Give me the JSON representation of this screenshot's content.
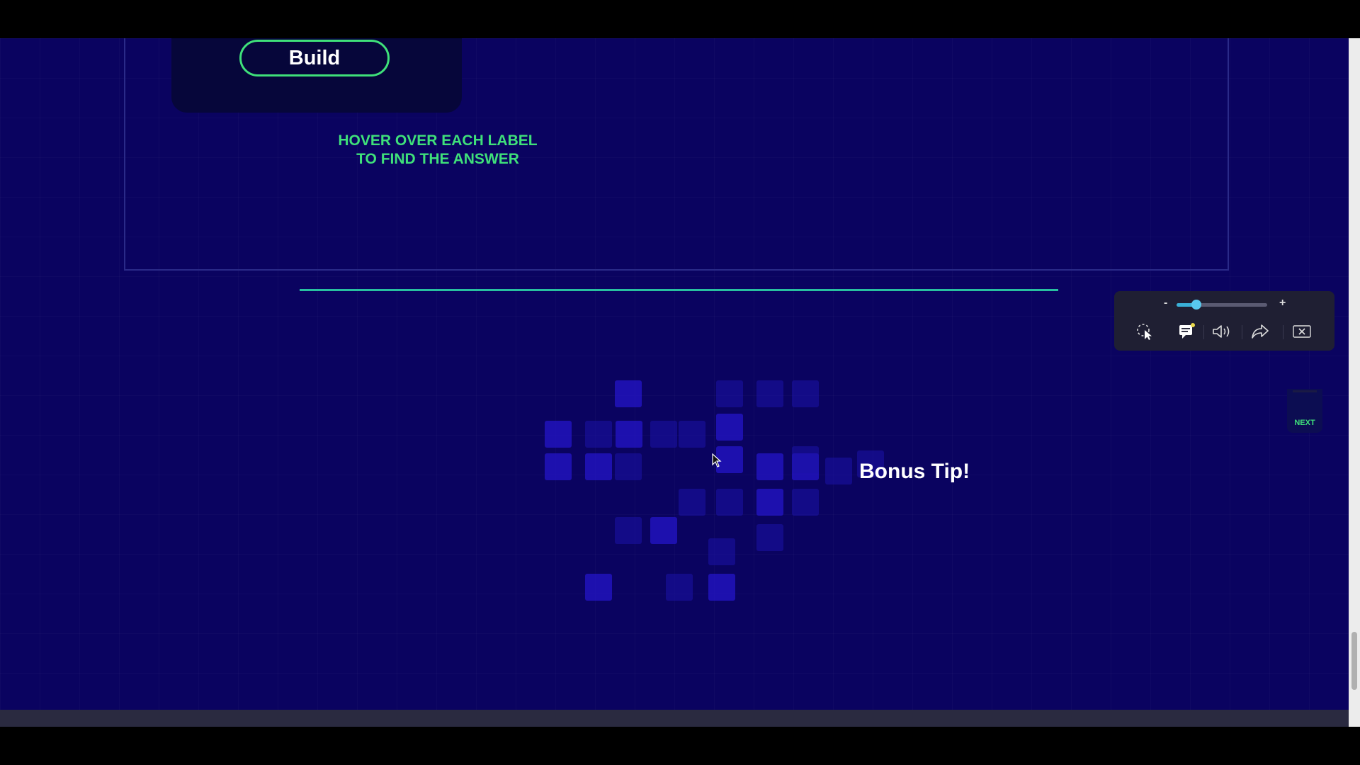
{
  "build_panel": {
    "button_label": "Build"
  },
  "hint": {
    "line1": "HOVER OVER EACH LABEL",
    "line2": "TO FIND THE ANSWER"
  },
  "bonus": {
    "title": "Bonus Tip!"
  },
  "toolbar": {
    "zoom_minus": "-",
    "zoom_plus": "+",
    "zoom_level": 0.22,
    "icons": [
      "pointer-select-icon",
      "caption-icon",
      "audio-icon",
      "share-icon",
      "exit-fullscreen-icon"
    ]
  },
  "next_tab": {
    "label": "NEXT"
  },
  "colors": {
    "background": "#0a0360",
    "accent_green": "#3fe07a",
    "divider": "#28c0a0",
    "zoom_accent": "#3ab0d8",
    "toolbar_bg": "#1f1f33"
  }
}
